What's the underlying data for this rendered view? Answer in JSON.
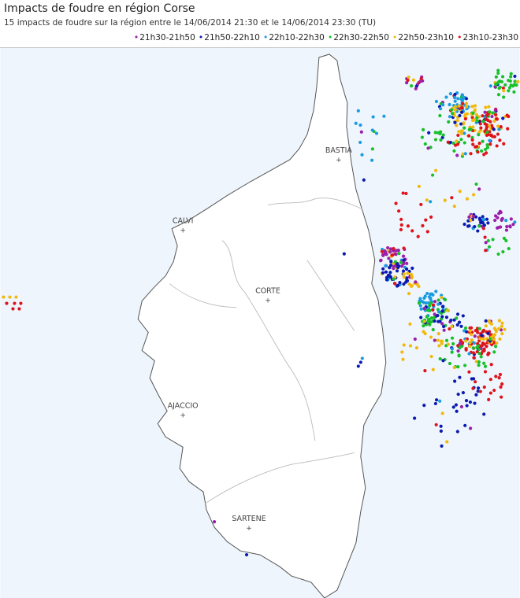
{
  "header": {
    "title": "Impacts de foudre en région Corse",
    "subtitle": "15 impacts de foudre sur la région entre le 14/06/2014 21:30 et le 14/06/2014 23:30 (TU)"
  },
  "legend": [
    {
      "label": "21h30-21h50",
      "color": "#9b1fa8"
    },
    {
      "label": "21h50-22h10",
      "color": "#0b1bb0"
    },
    {
      "label": "22h10-22h30",
      "color": "#1a9be0"
    },
    {
      "label": "22h30-22h50",
      "color": "#18c02a"
    },
    {
      "label": "22h50-23h10",
      "color": "#f2b90c"
    },
    {
      "label": "23h10-23h30",
      "color": "#e0121a"
    }
  ],
  "legend_dot": "•",
  "colors": {
    "sea": "#eef5fc",
    "land": "#ffffff",
    "coast": "#555555",
    "border": "#bbbbbb"
  },
  "cities": [
    {
      "name": "BASTIA",
      "marker": "+"
    },
    {
      "name": "CALVI",
      "marker": "+"
    },
    {
      "name": "CORTE",
      "marker": "+"
    },
    {
      "name": "AJACCIO",
      "marker": "+"
    },
    {
      "name": "SARTENE",
      "marker": "+"
    }
  ]
}
